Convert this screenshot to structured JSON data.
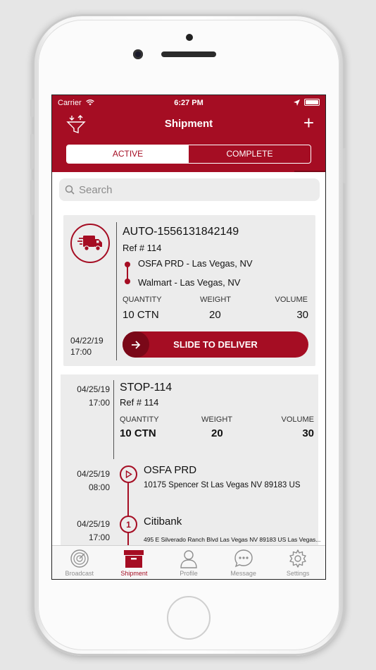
{
  "status_bar": {
    "carrier": "Carrier",
    "time": "6:27 PM"
  },
  "header": {
    "title": "Shipment",
    "add_label": "+",
    "segments": {
      "active": "ACTIVE",
      "complete": "COMPLETE"
    }
  },
  "search": {
    "placeholder": "Search"
  },
  "shipment_card": {
    "id": "AUTO-1556131842149",
    "ref": "Ref # 114",
    "from": "OSFA PRD - Las Vegas, NV",
    "to": "Walmart - Las Vegas, NV",
    "labels": {
      "quantity": "QUANTITY",
      "weight": "WEIGHT",
      "volume": "VOLUME"
    },
    "values": {
      "quantity": "10 CTN",
      "weight": "20",
      "volume": "30"
    },
    "date": "04/22/19",
    "time": "17:00",
    "slide_label": "SLIDE TO DELIVER"
  },
  "stop_card": {
    "id": "STOP-114",
    "ref": "Ref # 114",
    "date": "04/25/19",
    "time": "17:00",
    "labels": {
      "quantity": "QUANTITY",
      "weight": "WEIGHT",
      "volume": "VOLUME"
    },
    "values": {
      "quantity": "10 CTN",
      "weight": "20",
      "volume": "30"
    },
    "stops": [
      {
        "date": "04/25/19",
        "time": "08:00",
        "name": "OSFA PRD",
        "address": "10175 Spencer St Las Vegas NV 89183 US",
        "marker": "play-icon"
      },
      {
        "date": "04/25/19",
        "time": "17:00",
        "name": "Citibank",
        "address": "495 E Silverado Ranch Blvd Las Vegas NV 89183 US Las Vegas...",
        "marker": "1"
      }
    ]
  },
  "tabbar": {
    "items": [
      {
        "label": "Broadcast",
        "icon": "radar-icon"
      },
      {
        "label": "Shipment",
        "icon": "box-icon"
      },
      {
        "label": "Profile",
        "icon": "person-icon"
      },
      {
        "label": "Message",
        "icon": "chat-icon"
      },
      {
        "label": "Settings",
        "icon": "gear-icon"
      }
    ],
    "active": "Shipment"
  },
  "colors": {
    "brand": "#a50d23",
    "brand_dark": "#7a0818",
    "card_bg": "#ececec"
  }
}
